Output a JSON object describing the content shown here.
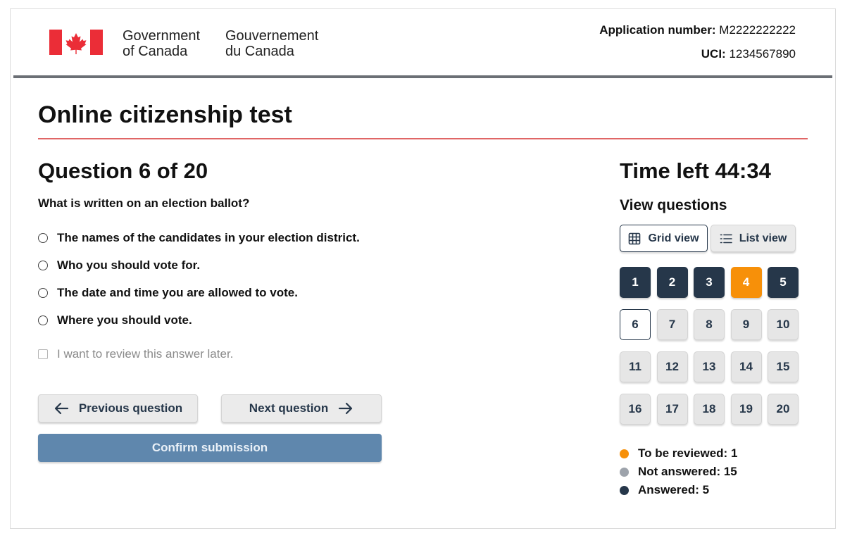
{
  "header": {
    "gov_en_line1": "Government",
    "gov_en_line2": "of Canada",
    "gov_fr_line1": "Gouvernement",
    "gov_fr_line2": "du Canada",
    "application_label": "Application number:",
    "application_value": "M2222222222",
    "uci_label": "UCI:",
    "uci_value": "1234567890",
    "flag_color": "#eb2d37"
  },
  "page_title": "Online citizenship test",
  "question": {
    "heading": "Question 6 of 20",
    "text": "What is written on an election ballot?",
    "options": [
      "The names of the candidates in your election district.",
      "Who you should vote for.",
      "The date and time you are allowed to vote.",
      "Where you should vote."
    ],
    "review_label": "I want to review this answer later."
  },
  "navigation": {
    "previous_label": "Previous question",
    "next_label": "Next question",
    "confirm_label": "Confirm submission"
  },
  "sidebar": {
    "time_left": "Time left 44:34",
    "view_questions": "View questions",
    "grid_view_label": "Grid view",
    "list_view_label": "List view",
    "questions": [
      {
        "label": "1",
        "status": "answered"
      },
      {
        "label": "2",
        "status": "answered"
      },
      {
        "label": "3",
        "status": "answered"
      },
      {
        "label": "4",
        "status": "review"
      },
      {
        "label": "5",
        "status": "answered"
      },
      {
        "label": "6",
        "status": "current"
      },
      {
        "label": "7",
        "status": "unanswered"
      },
      {
        "label": "8",
        "status": "unanswered"
      },
      {
        "label": "9",
        "status": "unanswered"
      },
      {
        "label": "10",
        "status": "unanswered"
      },
      {
        "label": "11",
        "status": "unanswered"
      },
      {
        "label": "12",
        "status": "unanswered"
      },
      {
        "label": "13",
        "status": "unanswered"
      },
      {
        "label": "14",
        "status": "unanswered"
      },
      {
        "label": "15",
        "status": "unanswered"
      },
      {
        "label": "16",
        "status": "unanswered"
      },
      {
        "label": "17",
        "status": "unanswered"
      },
      {
        "label": "18",
        "status": "unanswered"
      },
      {
        "label": "19",
        "status": "unanswered"
      },
      {
        "label": "20",
        "status": "unanswered"
      }
    ],
    "legend": [
      {
        "label": "To be reviewed: 1",
        "color": "#f79009"
      },
      {
        "label": "Not answered: 15",
        "color": "#9da3ab"
      },
      {
        "label": "Answered: 5",
        "color": "#26374a"
      }
    ]
  }
}
